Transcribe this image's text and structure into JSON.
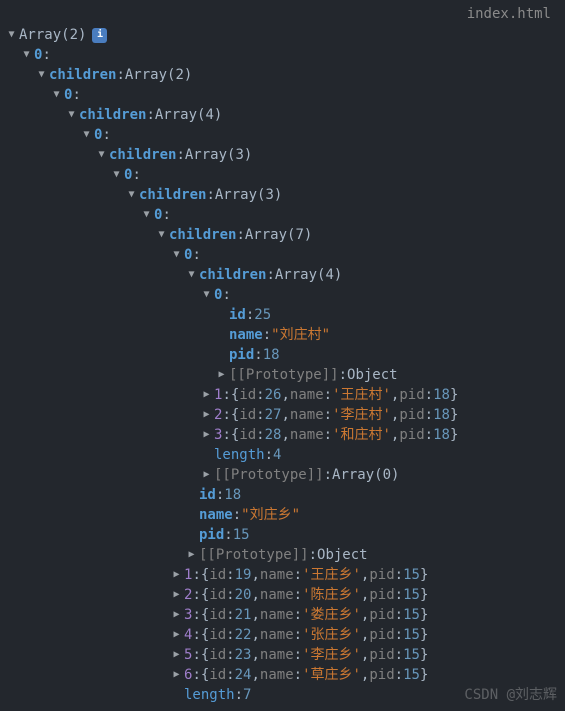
{
  "filetab": "index.html",
  "root": {
    "label": "Array",
    "len": 2
  },
  "L0": {
    "idx": "0"
  },
  "L0_children": {
    "label": "children",
    "type": "Array",
    "len": 2
  },
  "L1": {
    "idx": "0"
  },
  "L1_children": {
    "label": "children",
    "type": "Array",
    "len": 4
  },
  "L2": {
    "idx": "0"
  },
  "L2_children": {
    "label": "children",
    "type": "Array",
    "len": 3
  },
  "L3": {
    "idx": "0"
  },
  "L3_children": {
    "label": "children",
    "type": "Array",
    "len": 3
  },
  "L4": {
    "idx": "0"
  },
  "L4_children": {
    "label": "children",
    "type": "Array",
    "len": 7
  },
  "L5": {
    "idx": "0"
  },
  "L5_children": {
    "label": "children",
    "type": "Array",
    "len": 4
  },
  "L6": {
    "idx": "0"
  },
  "leaf": {
    "id_key": "id",
    "id_val": 25,
    "name_key": "name",
    "name_val": "\"刘庄村\"",
    "pid_key": "pid",
    "pid_val": 18
  },
  "proto": {
    "label": "[[Prototype]]",
    "obj": "Object",
    "arr0": "Array(0)"
  },
  "L5siblings": [
    {
      "idx": "1",
      "id": 26,
      "name": "'王庄村'",
      "pid": 18
    },
    {
      "idx": "2",
      "id": 27,
      "name": "'李庄村'",
      "pid": 18
    },
    {
      "idx": "3",
      "id": 28,
      "name": "'和庄村'",
      "pid": 18
    }
  ],
  "L5len": {
    "label": "length",
    "val": 4
  },
  "L4tail": {
    "id_key": "id",
    "id_val": 18,
    "name_key": "name",
    "name_val": "\"刘庄乡\"",
    "pid_key": "pid",
    "pid_val": 15
  },
  "L4siblings": [
    {
      "idx": "1",
      "id": 19,
      "name": "'王庄乡'",
      "pid": 15
    },
    {
      "idx": "2",
      "id": 20,
      "name": "'陈庄乡'",
      "pid": 15
    },
    {
      "idx": "3",
      "id": 21,
      "name": "'娄庄乡'",
      "pid": 15
    },
    {
      "idx": "4",
      "id": 22,
      "name": "'张庄乡'",
      "pid": 15
    },
    {
      "idx": "5",
      "id": 23,
      "name": "'李庄乡'",
      "pid": 15
    },
    {
      "idx": "6",
      "id": 24,
      "name": "'草庄乡'",
      "pid": 15
    }
  ],
  "L4len": {
    "label": "length",
    "val": 7
  },
  "keys": {
    "id": "id",
    "name": "name",
    "pid": "pid"
  },
  "watermark": "CSDN @刘志辉"
}
